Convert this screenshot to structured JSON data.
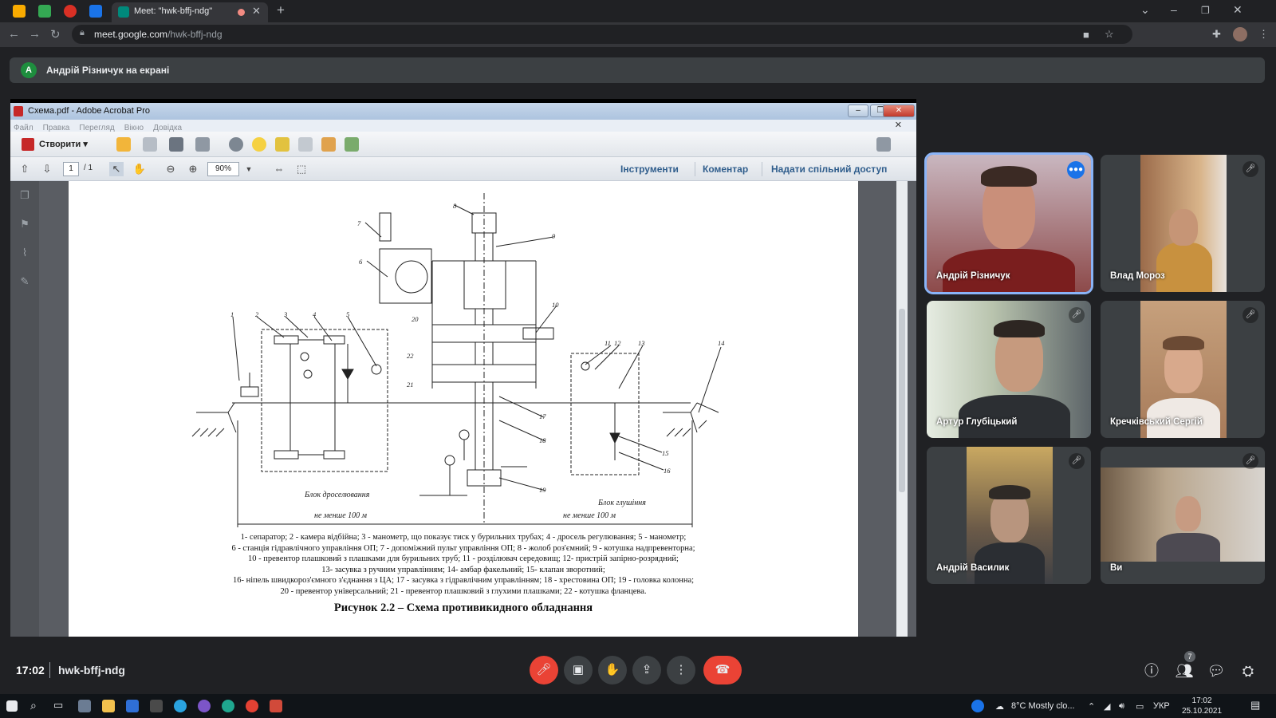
{
  "browser": {
    "tab_title": "Meet: \"hwk-bffj-ndg\"",
    "url_host": "meet.google.com",
    "url_path": "/hwk-bffj-ndg"
  },
  "banner": {
    "avatar_letter": "A",
    "text": "Андрій Різничук на екрані"
  },
  "acrobat": {
    "window_title": "Схема.pdf - Adobe Acrobat Pro",
    "menu": [
      "Файл",
      "Правка",
      "Перегляд",
      "Вікно",
      "Довідка"
    ],
    "create_label": "Створити",
    "page_current": "1",
    "page_total": "/ 1",
    "zoom": "90%",
    "tools_label": "Інструменти",
    "comment_label": "Коментар",
    "share_label": "Надати спільний доступ"
  },
  "document": {
    "numbers": [
      "1",
      "2",
      "3",
      "4",
      "5",
      "6",
      "7",
      "8",
      "9",
      "10",
      "11",
      "12",
      "13",
      "14",
      "15",
      "16",
      "17",
      "18",
      "19",
      "20",
      "21",
      "22"
    ],
    "block_choke": "Блок дроселювання",
    "block_kill": "Блок глушіння",
    "min_left": "не менше 100 м",
    "min_right": "не менше 100 м",
    "caption": [
      "1- сепаратор; 2 - камера відбійна; 3 - манометр, що показує тиск у бурильних трубах; 4 - дросель регулювання; 5 - манометр;",
      "6 - станція гідравлічного управління ОП; 7 - допоміжний пульт управління ОП; 8 - жолоб роз'ємний; 9 - котушка надпревенторна;",
      "10 - превентор плашковий з плашками для бурильних труб; 11 - розділювач середовищ; 12- пристрій запірно-розрядний;",
      "13- засувка з ручним управлінням; 14- амбар факельний; 15- клапан зворотний;",
      "16- ніпель швидкороз'ємного з'єднання з ЦА; 17 - засувка з гідравлічним управлінням; 18 - хрестовина ОП; 19 - головка колонна;",
      "20 - превентор універсальний; 21 - превентор плашковий з глухими плашками; 22 - котушка фланцева."
    ],
    "figure_title": "Рисунок 2.2 – Схема противикидного обладнання"
  },
  "participants": [
    {
      "name": "Андрій Різничук",
      "speaking": true
    },
    {
      "name": "Влад Мороз",
      "muted": true
    },
    {
      "name": "Артур Глубіцький",
      "muted": true
    },
    {
      "name": "Кречківський Сергій",
      "muted": true
    },
    {
      "name": "Андрій Василик",
      "muted": true
    },
    {
      "name": "Ви",
      "muted": true
    }
  ],
  "meeting": {
    "time": "17:02",
    "code": "hwk-bffj-ndg",
    "participant_count": "7"
  },
  "taskbar": {
    "weather": "8°C  Mostly clo...",
    "lang": "УКР",
    "time": "17:02",
    "date": "25.10.2021"
  },
  "colors": {
    "end_call": "#ea4335",
    "mic_off": "#ea4335",
    "speaking": "#1a73e8",
    "presenter_avatar": "#1e8e3e"
  }
}
